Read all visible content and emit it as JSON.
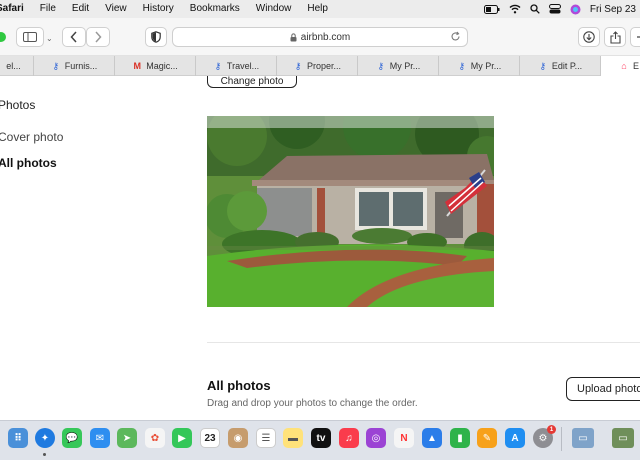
{
  "menubar": {
    "app": "Safari",
    "items": [
      "File",
      "Edit",
      "View",
      "History",
      "Bookmarks",
      "Window",
      "Help"
    ],
    "clock": "Fri Sep 23"
  },
  "toolbar": {
    "url": "airbnb.com"
  },
  "tabs": [
    {
      "label": "el...",
      "icon": "doc-icon",
      "color": "#5b8def"
    },
    {
      "label": "Furnis...",
      "icon": "key-icon",
      "color": "#2c63d6"
    },
    {
      "label": "Magic...",
      "icon": "gmail-icon",
      "color": "#d93025"
    },
    {
      "label": "Travel...",
      "icon": "key-icon",
      "color": "#2c63d6"
    },
    {
      "label": "Proper...",
      "icon": "key-icon",
      "color": "#2c63d6"
    },
    {
      "label": "My Pr...",
      "icon": "key-icon",
      "color": "#2c63d6"
    },
    {
      "label": "My Pr...",
      "icon": "key-icon",
      "color": "#2c63d6"
    },
    {
      "label": "Edit P...",
      "icon": "key-icon",
      "color": "#2c63d6"
    },
    {
      "label": "E",
      "icon": "airbnb-icon",
      "color": "#ff385c"
    }
  ],
  "sidebar": {
    "heading": "Photos",
    "items": [
      "Cover photo",
      "All photos"
    ]
  },
  "main": {
    "change_photo": "Change photo",
    "all_photos_title": "All photos",
    "all_photos_subtitle": "Drag and drop your photos to change the order.",
    "upload_button": "Upload photos"
  },
  "dock": {
    "calendar_day": "23",
    "settings_badge": "1"
  }
}
